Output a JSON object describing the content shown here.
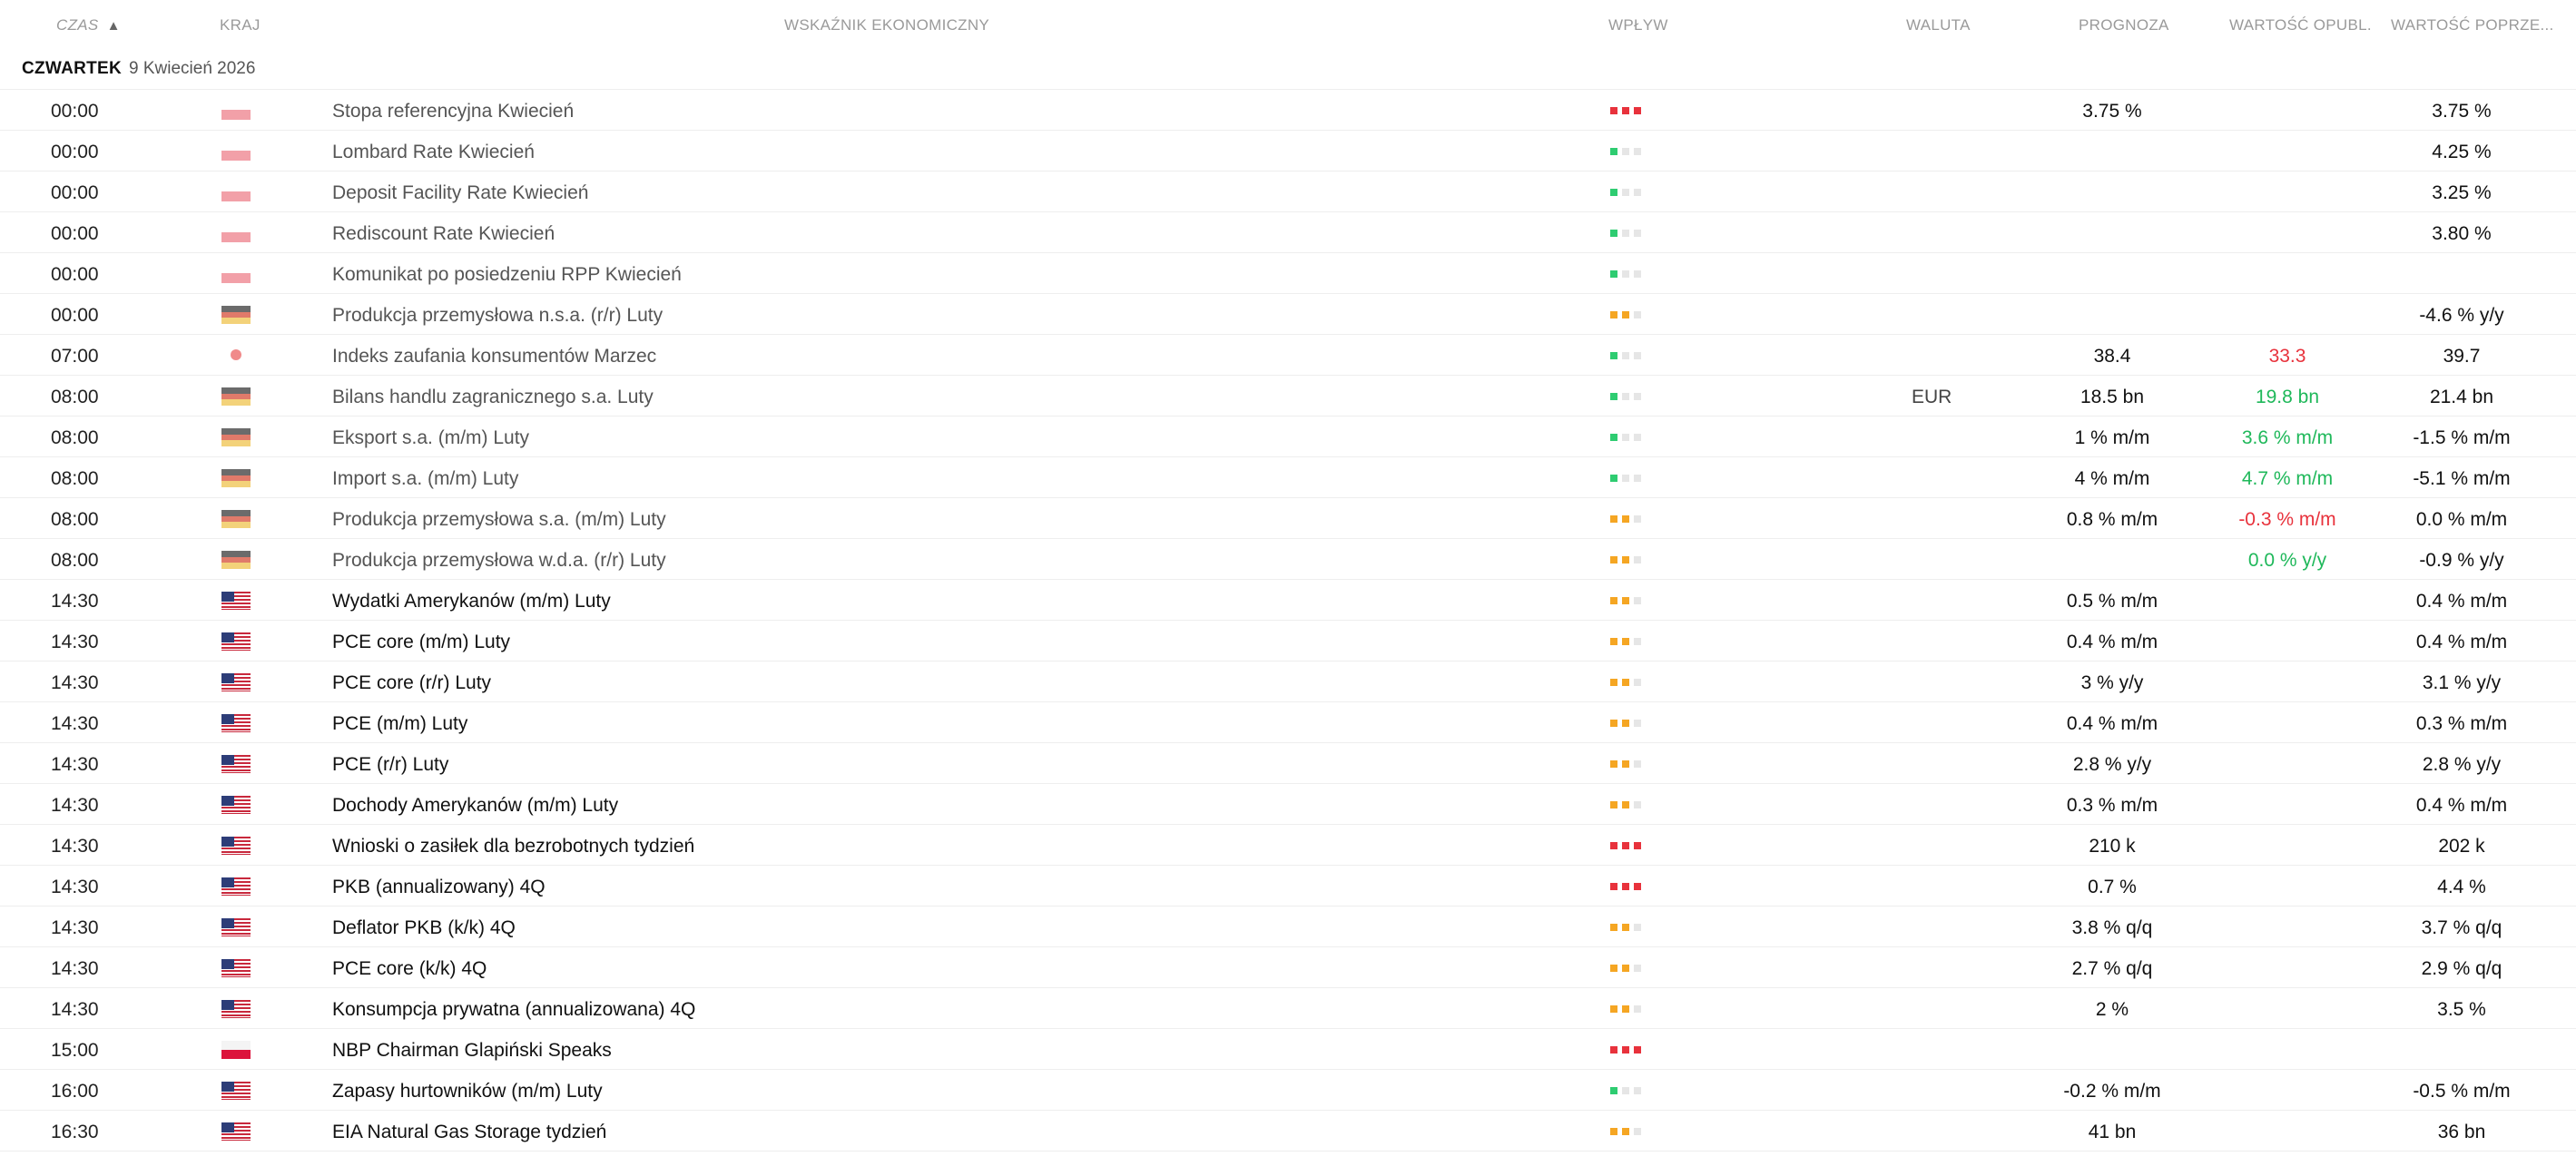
{
  "header": {
    "time": "CZAS",
    "sort_arrow": "▲",
    "country": "KRAJ",
    "indicator": "WSKAŹNIK EKONOMICZNY",
    "impact": "WPŁYW",
    "currency": "WALUTA",
    "forecast": "PROGNOZA",
    "actual": "WARTOŚĆ OPUBL.",
    "previous": "WARTOŚĆ POPRZE..."
  },
  "day": {
    "weekday": "CZWARTEK",
    "date": "9 Kwiecień 2026"
  },
  "colors": {
    "impact_high": "#e8323c",
    "impact_medium": "#f5a623",
    "impact_low": "#2ecc71",
    "impact_off": "#e6e6e6",
    "positive": "#1fb85a",
    "negative": "#e8323c"
  },
  "rows": [
    {
      "time": "00:00",
      "country": "PL",
      "flag": "flag-pl-faded",
      "name": "Stopa referencyjna Kwiecień",
      "impact": "high",
      "muted": true,
      "currency": "",
      "forecast": "3.75 %",
      "actual": "",
      "actual_state": "",
      "previous": "3.75 %"
    },
    {
      "time": "00:00",
      "country": "PL",
      "flag": "flag-pl-faded",
      "name": "Lombard Rate Kwiecień",
      "impact": "low",
      "muted": true,
      "currency": "",
      "forecast": "",
      "actual": "",
      "actual_state": "",
      "previous": "4.25 %"
    },
    {
      "time": "00:00",
      "country": "PL",
      "flag": "flag-pl-faded",
      "name": "Deposit Facility Rate Kwiecień",
      "impact": "low",
      "muted": true,
      "currency": "",
      "forecast": "",
      "actual": "",
      "actual_state": "",
      "previous": "3.25 %"
    },
    {
      "time": "00:00",
      "country": "PL",
      "flag": "flag-pl-faded",
      "name": "Rediscount Rate Kwiecień",
      "impact": "low",
      "muted": true,
      "currency": "",
      "forecast": "",
      "actual": "",
      "actual_state": "",
      "previous": "3.80 %"
    },
    {
      "time": "00:00",
      "country": "PL",
      "flag": "flag-pl-faded",
      "name": "Komunikat po posiedzeniu RPP Kwiecień",
      "impact": "low",
      "muted": true,
      "currency": "",
      "forecast": "",
      "actual": "",
      "actual_state": "",
      "previous": ""
    },
    {
      "time": "00:00",
      "country": "DE",
      "flag": "flag-de-faded",
      "name": "Produkcja przemysłowa n.s.a. (r/r) Luty",
      "impact": "medium",
      "muted": true,
      "currency": "",
      "forecast": "",
      "actual": "",
      "actual_state": "",
      "previous": "-4.6 % y/y"
    },
    {
      "time": "07:00",
      "country": "JP",
      "flag": "flag-jp-faded",
      "name": "Indeks zaufania konsumentów Marzec",
      "impact": "low",
      "muted": true,
      "currency": "",
      "forecast": "38.4",
      "actual": "33.3",
      "actual_state": "negative",
      "previous": "39.7"
    },
    {
      "time": "08:00",
      "country": "DE",
      "flag": "flag-de-faded",
      "name": "Bilans handlu zagranicznego s.a. Luty",
      "impact": "low",
      "muted": true,
      "currency": "EUR",
      "forecast": "18.5 bn",
      "actual": "19.8 bn",
      "actual_state": "positive",
      "previous": "21.4 bn"
    },
    {
      "time": "08:00",
      "country": "DE",
      "flag": "flag-de-faded",
      "name": "Eksport s.a. (m/m) Luty",
      "impact": "low",
      "muted": true,
      "currency": "",
      "forecast": "1 % m/m",
      "actual": "3.6 % m/m",
      "actual_state": "positive",
      "previous": "-1.5 % m/m"
    },
    {
      "time": "08:00",
      "country": "DE",
      "flag": "flag-de-faded",
      "name": "Import s.a. (m/m) Luty",
      "impact": "low",
      "muted": true,
      "currency": "",
      "forecast": "4 % m/m",
      "actual": "4.7 % m/m",
      "actual_state": "positive",
      "previous": "-5.1 % m/m"
    },
    {
      "time": "08:00",
      "country": "DE",
      "flag": "flag-de-faded",
      "name": "Produkcja przemysłowa s.a. (m/m) Luty",
      "impact": "medium",
      "muted": true,
      "currency": "",
      "forecast": "0.8 % m/m",
      "actual": "-0.3 % m/m",
      "actual_state": "negative",
      "previous": "0.0 % m/m"
    },
    {
      "time": "08:00",
      "country": "DE",
      "flag": "flag-de-faded",
      "name": "Produkcja przemysłowa w.d.a. (r/r) Luty",
      "impact": "medium",
      "muted": true,
      "currency": "",
      "forecast": "",
      "actual": "0.0 % y/y",
      "actual_state": "positive",
      "previous": "-0.9 % y/y"
    },
    {
      "time": "14:30",
      "country": "US",
      "flag": "flag-us",
      "name": "Wydatki Amerykanów (m/m) Luty",
      "impact": "medium",
      "muted": false,
      "currency": "",
      "forecast": "0.5 % m/m",
      "actual": "",
      "actual_state": "",
      "previous": "0.4 % m/m"
    },
    {
      "time": "14:30",
      "country": "US",
      "flag": "flag-us",
      "name": "PCE core (m/m) Luty",
      "impact": "medium",
      "muted": false,
      "currency": "",
      "forecast": "0.4 % m/m",
      "actual": "",
      "actual_state": "",
      "previous": "0.4 % m/m"
    },
    {
      "time": "14:30",
      "country": "US",
      "flag": "flag-us",
      "name": "PCE core (r/r) Luty",
      "impact": "medium",
      "muted": false,
      "currency": "",
      "forecast": "3 % y/y",
      "actual": "",
      "actual_state": "",
      "previous": "3.1 % y/y"
    },
    {
      "time": "14:30",
      "country": "US",
      "flag": "flag-us",
      "name": "PCE (m/m) Luty",
      "impact": "medium",
      "muted": false,
      "currency": "",
      "forecast": "0.4 % m/m",
      "actual": "",
      "actual_state": "",
      "previous": "0.3 % m/m"
    },
    {
      "time": "14:30",
      "country": "US",
      "flag": "flag-us",
      "name": "PCE (r/r) Luty",
      "impact": "medium",
      "muted": false,
      "currency": "",
      "forecast": "2.8 % y/y",
      "actual": "",
      "actual_state": "",
      "previous": "2.8 % y/y"
    },
    {
      "time": "14:30",
      "country": "US",
      "flag": "flag-us",
      "name": "Dochody Amerykanów (m/m) Luty",
      "impact": "medium",
      "muted": false,
      "currency": "",
      "forecast": "0.3 % m/m",
      "actual": "",
      "actual_state": "",
      "previous": "0.4 % m/m"
    },
    {
      "time": "14:30",
      "country": "US",
      "flag": "flag-us",
      "name": "Wnioski o zasiłek dla bezrobotnych tydzień",
      "impact": "high",
      "muted": false,
      "currency": "",
      "forecast": "210 k",
      "actual": "",
      "actual_state": "",
      "previous": "202 k"
    },
    {
      "time": "14:30",
      "country": "US",
      "flag": "flag-us",
      "name": "PKB (annualizowany) 4Q",
      "impact": "high",
      "muted": false,
      "currency": "",
      "forecast": "0.7 %",
      "actual": "",
      "actual_state": "",
      "previous": "4.4 %"
    },
    {
      "time": "14:30",
      "country": "US",
      "flag": "flag-us",
      "name": "Deflator PKB (k/k) 4Q",
      "impact": "medium",
      "muted": false,
      "currency": "",
      "forecast": "3.8 % q/q",
      "actual": "",
      "actual_state": "",
      "previous": "3.7 % q/q"
    },
    {
      "time": "14:30",
      "country": "US",
      "flag": "flag-us",
      "name": "PCE core (k/k) 4Q",
      "impact": "medium",
      "muted": false,
      "currency": "",
      "forecast": "2.7 % q/q",
      "actual": "",
      "actual_state": "",
      "previous": "2.9 % q/q"
    },
    {
      "time": "14:30",
      "country": "US",
      "flag": "flag-us",
      "name": "Konsumpcja prywatna (annualizowana) 4Q",
      "impact": "medium",
      "muted": false,
      "currency": "",
      "forecast": "2 %",
      "actual": "",
      "actual_state": "",
      "previous": "3.5 %"
    },
    {
      "time": "15:00",
      "country": "PL",
      "flag": "flag-pl",
      "name": "NBP Chairman Glapiński Speaks",
      "impact": "high",
      "muted": false,
      "currency": "",
      "forecast": "",
      "actual": "",
      "actual_state": "",
      "previous": ""
    },
    {
      "time": "16:00",
      "country": "US",
      "flag": "flag-us",
      "name": "Zapasy hurtowników (m/m) Luty",
      "impact": "low",
      "muted": false,
      "currency": "",
      "forecast": "-0.2 % m/m",
      "actual": "",
      "actual_state": "",
      "previous": "-0.5 % m/m"
    },
    {
      "time": "16:30",
      "country": "US",
      "flag": "flag-us",
      "name": "EIA Natural Gas Storage tydzień",
      "impact": "medium",
      "muted": false,
      "currency": "",
      "forecast": "41 bn",
      "actual": "",
      "actual_state": "",
      "previous": "36 bn"
    }
  ]
}
